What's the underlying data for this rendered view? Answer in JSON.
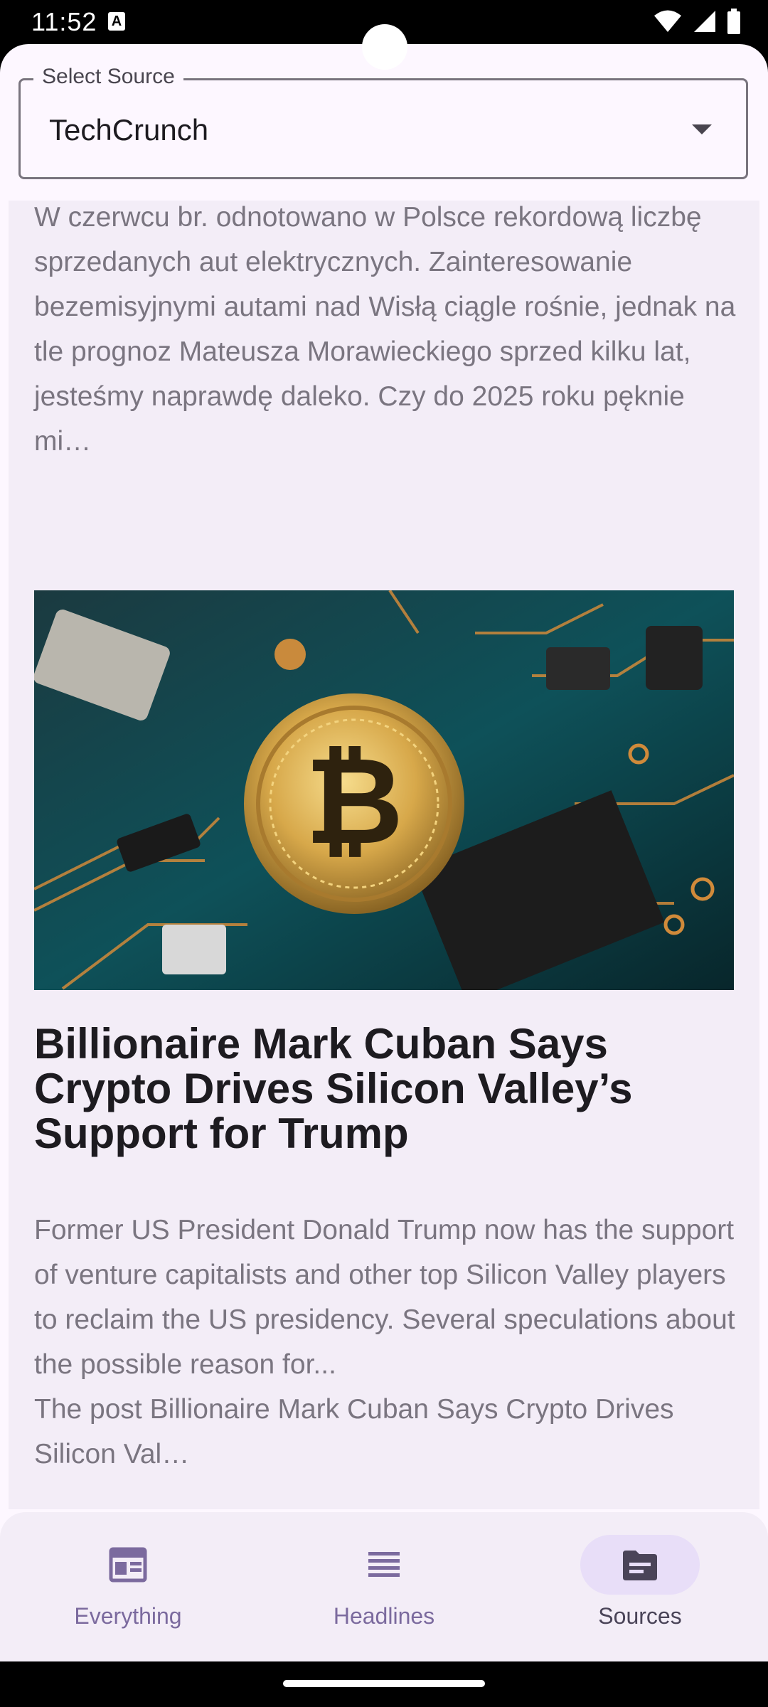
{
  "status_bar": {
    "time": "11:52",
    "notification_icon": "A"
  },
  "source_select": {
    "label": "Select Source",
    "value": "TechCrunch"
  },
  "articles": [
    {
      "description": "W czerwcu br. odnotowano w Polsce rekordową liczbę sprzedanych aut elektrycznych. Zainteresowanie bezemisyjnymi autami nad Wisłą ciągle rośnie, jednak na tle prognoz Mateusza Morawieckiego sprzed kilku lat, jesteśmy naprawdę daleko. Czy do 2025 roku pęknie mi…"
    },
    {
      "image": "bitcoin-on-circuit-board",
      "title": "Billionaire Mark Cuban Says Crypto Drives Silicon Valley’s Support for Trump",
      "description": "Former US President Donald Trump now has the support of venture capitalists and other top Silicon Valley players to reclaim the US presidency. Several speculations about the possible reason for...\nThe post Billionaire Mark Cuban Says Crypto Drives Silicon Val…"
    }
  ],
  "bottom_nav": {
    "items": [
      {
        "label": "Everything",
        "icon": "newspaper-icon"
      },
      {
        "label": "Headlines",
        "icon": "list-icon"
      },
      {
        "label": "Sources",
        "icon": "source-icon"
      }
    ],
    "active": "Sources"
  },
  "colors": {
    "background": "#fdf7ff",
    "card": "#f3edf7",
    "accent": "#7b6a9e",
    "active_indicator": "#e8def8"
  }
}
